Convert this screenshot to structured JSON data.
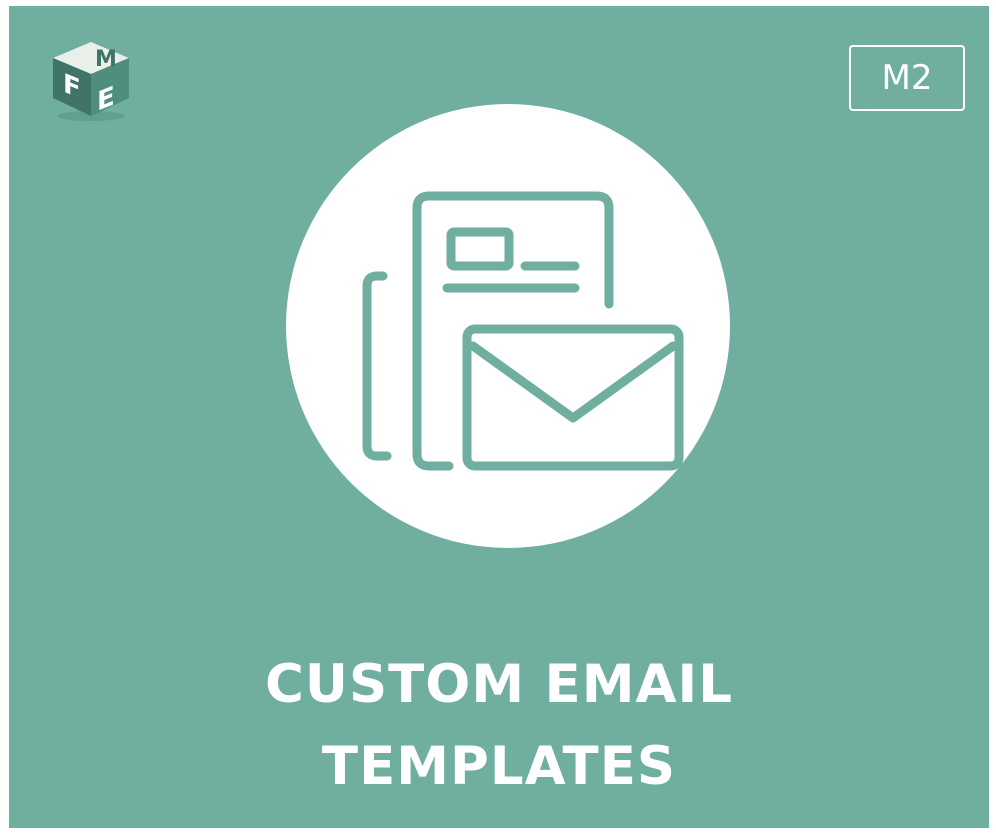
{
  "colors": {
    "background": "#70ae9f",
    "accent": "#ffffff",
    "icon_stroke": "#70ae9f"
  },
  "logo": {
    "icon": "fme-cube-logo",
    "letters": "FME"
  },
  "badge": {
    "text": "M2"
  },
  "illustration": {
    "icon": "email-template-icon"
  },
  "title": {
    "line1": "CUSTOM EMAIL",
    "line2": "TEMPLATES"
  }
}
